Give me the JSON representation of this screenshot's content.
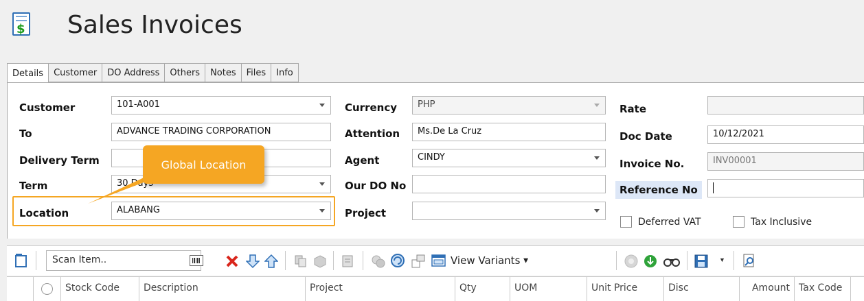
{
  "window": {
    "title": "Sales Invoices"
  },
  "tabs": [
    "Details",
    "Customer",
    "DO Address",
    "Others",
    "Notes",
    "Files",
    "Info"
  ],
  "form": {
    "customer": {
      "label": "Customer",
      "value": "101-A001"
    },
    "to": {
      "label": "To",
      "value": "ADVANCE TRADING CORPORATION"
    },
    "delivery_term": {
      "label": "Delivery Term",
      "value": ""
    },
    "term": {
      "label": "Term",
      "value": "30 Days"
    },
    "location": {
      "label": "Location",
      "value": "ALABANG"
    },
    "currency": {
      "label": "Currency",
      "value": "PHP"
    },
    "attention": {
      "label": "Attention",
      "value": "Ms.De La Cruz"
    },
    "agent": {
      "label": "Agent",
      "value": "CINDY"
    },
    "our_do_no": {
      "label": "Our DO No",
      "value": ""
    },
    "project": {
      "label": "Project",
      "value": ""
    },
    "rate": {
      "label": "Rate",
      "value": ""
    },
    "doc_date": {
      "label": "Doc Date",
      "value": "10/12/2021"
    },
    "invoice_no": {
      "label": "Invoice No.",
      "value": "INV00001"
    },
    "reference_no": {
      "label": "Reference No",
      "value": ""
    },
    "deferred_vat": {
      "label": "Deferred VAT"
    },
    "tax_inclusive": {
      "label": "Tax Inclusive"
    }
  },
  "callout": {
    "text": "Global Location"
  },
  "toolbar": {
    "scan_placeholder": "Scan Item..",
    "view_variants": "View Variants"
  },
  "grid": {
    "columns": [
      "Stock Code",
      "Description",
      "Project",
      "Qty",
      "UOM",
      "Unit Price",
      "Disc",
      "Amount",
      "Tax Code"
    ]
  },
  "colors": {
    "highlight": "#f5a623",
    "accent": "#2f6fb5"
  }
}
